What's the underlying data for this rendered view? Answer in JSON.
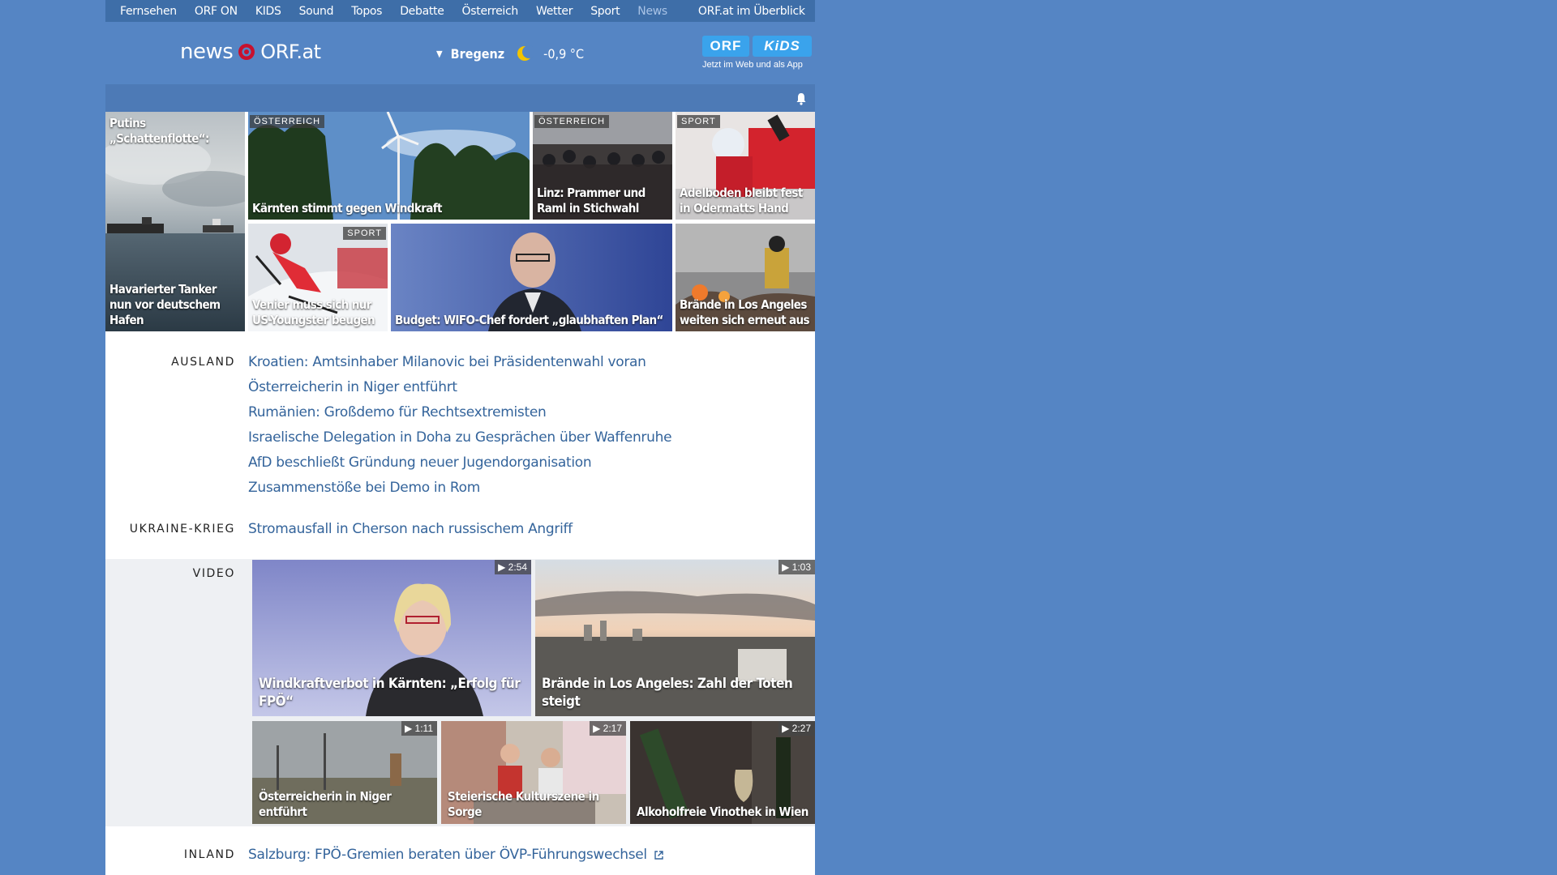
{
  "topnav": [
    "Fernsehen",
    "ORF ON",
    "KIDS",
    "Sound",
    "Topos",
    "Debatte",
    "Österreich",
    "Wetter",
    "Sport",
    "News"
  ],
  "topnav_overview": "ORF.at im Überblick",
  "logo": {
    "news": "news",
    "orfat": "ORF.at"
  },
  "weather": {
    "city": "Bregenz",
    "temp": "-0,9 °C",
    "icon": "moon-icon"
  },
  "kids_ad": {
    "orf": "ORF",
    "kids": "KiDS",
    "sub": "Jetzt im Web und als App"
  },
  "tiles": [
    {
      "caption_top": "Putins „Schattenflotte“:",
      "caption": "Havarierter Tanker nun vor deutschem Hafen"
    },
    {
      "tag": "ÖSTERREICH",
      "caption": "Kärnten stimmt gegen Windkraft"
    },
    {
      "tag": "ÖSTERREICH",
      "caption": "Linz: Prammer und Raml in Stichwahl"
    },
    {
      "tag": "SPORT",
      "caption": "Adelboden bleibt fest in Odermatts Hand"
    },
    {
      "tag": "SPORT",
      "caption": "Venier muss sich nur US-Youngster beugen"
    },
    {
      "caption": "Budget: WIFO-Chef fordert „glaubhaften Plan“"
    },
    {
      "caption": "Brände in Los Angeles weiten sich erneut aus"
    }
  ],
  "sections": {
    "ausland": {
      "label": "AUSLAND",
      "links": [
        "Kroatien: Amtsinhaber Milanovic bei Präsidentenwahl voran",
        "Österreicherin in Niger entführt",
        "Rumänien: Großdemo für Rechtsextremisten",
        "Israelische Delegation in Doha zu Gesprächen über Waffenruhe",
        "AfD beschließt Gründung neuer Jugendorganisation",
        "Zusammenstöße bei Demo in Rom"
      ]
    },
    "ukraine": {
      "label": "UKRAINE-KRIEG",
      "links": [
        "Stromausfall in Cherson nach russischem Angriff"
      ]
    },
    "video": {
      "label": "VIDEO",
      "items": [
        {
          "duration": "2:54",
          "caption": "Windkraftverbot in Kärnten: „Erfolg für FPÖ“"
        },
        {
          "duration": "1:03",
          "caption": "Brände in Los Angeles: Zahl der Toten steigt"
        },
        {
          "duration": "1:11",
          "caption": "Österreicherin in Niger entführt"
        },
        {
          "duration": "2:17",
          "caption": "Steierische Kulturszene in Sorge"
        },
        {
          "duration": "2:27",
          "caption": "Alkoholfreie Vinothek in Wien"
        }
      ]
    },
    "inland": {
      "label": "INLAND",
      "links": [
        "Salzburg: FPÖ-Gremien beraten über ÖVP-Führungswechsel"
      ]
    }
  },
  "colors": {
    "page_bg": "#5585c4",
    "topnav_bg": "#3e6ea8",
    "link": "#34649b",
    "orf_red": "#c8102e"
  }
}
